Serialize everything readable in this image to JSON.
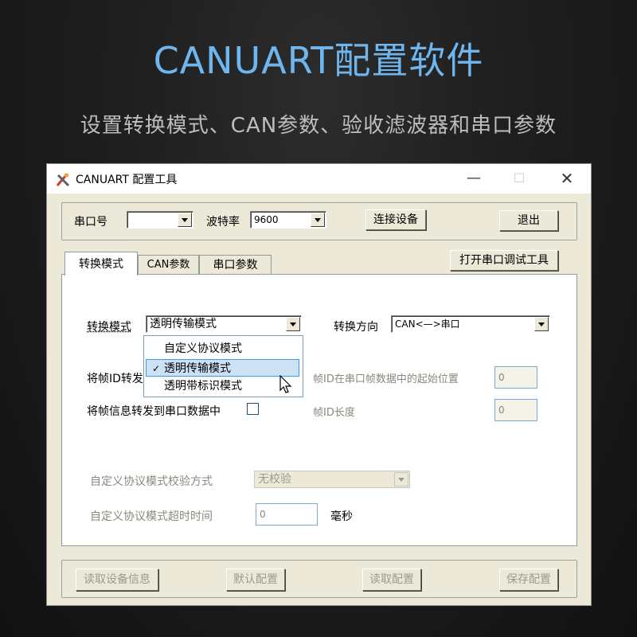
{
  "hero": {
    "title": "CANUART配置软件",
    "subtitle": "设置转换模式、CAN参数、验收滤波器和串口参数"
  },
  "window": {
    "title": "CANUART 配置工具",
    "minimize": "—",
    "maximize": "☐",
    "close": "✕"
  },
  "serial": {
    "port_label": "串口号",
    "port_value": "",
    "baud_label": "波特率",
    "baud_value": "9600",
    "connect_button": "连接设备",
    "exit_button": "退出"
  },
  "tabs": {
    "items": [
      "转换模式",
      "CAN参数",
      "串口参数"
    ],
    "active": 0,
    "open_debug_button": "打开串口调试工具"
  },
  "mode_tab": {
    "mode_label": "转换模式",
    "mode_value": "透明传输模式",
    "mode_options": [
      "自定义协议模式",
      "透明传输模式",
      "透明带标识模式"
    ],
    "mode_selected_index": 1,
    "direction_label": "转换方向",
    "direction_value": "CAN<—>串口",
    "frame_id_label": "将帧ID转发",
    "frame_info_label": "将帧信息转发到串口数据中",
    "frame_info_checked": false,
    "id_start_label": "帧ID在串口帧数据中的起始位置",
    "id_start_value": "0",
    "id_length_label": "帧ID长度",
    "id_length_value": "0",
    "checksum_label": "自定义协议模式校验方式",
    "checksum_value": "无校验",
    "timeout_label": "自定义协议模式超时时间",
    "timeout_value": "0",
    "timeout_unit": "毫秒"
  },
  "footer": {
    "read_info_button": "读取设备信息",
    "default_button": "默认配置",
    "read_config_button": "读取配置",
    "save_button": "保存配置"
  },
  "colors": {
    "hero_title": "#6fb6ef",
    "window_bg": "#ece9d8",
    "selection": "#cde1f5",
    "selection_border": "#3399ff"
  }
}
